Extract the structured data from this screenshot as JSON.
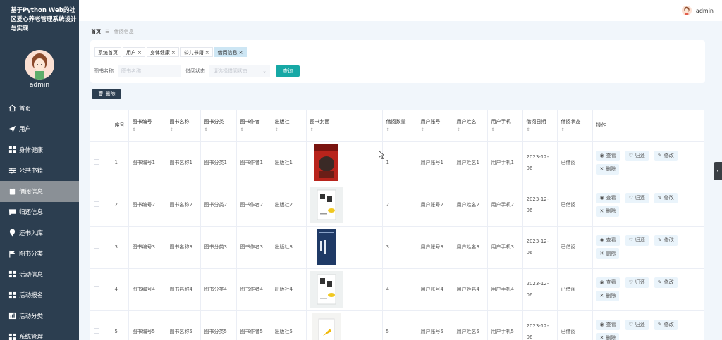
{
  "app": {
    "title": "基于Python Web的社区爱心养老管理系统设计与实现",
    "username": "admin"
  },
  "sidebar": {
    "items": [
      {
        "label": "首页",
        "icon": "home-icon"
      },
      {
        "label": "用户",
        "icon": "send-icon"
      },
      {
        "label": "身体健康",
        "icon": "grid-icon"
      },
      {
        "label": "公共书籍",
        "icon": "sliders-icon"
      },
      {
        "label": "借阅信息",
        "icon": "clipboard-icon",
        "active": true
      },
      {
        "label": "归还信息",
        "icon": "chat-icon"
      },
      {
        "label": "还书入库",
        "icon": "pin-icon"
      },
      {
        "label": "图书分类",
        "icon": "flag-icon"
      },
      {
        "label": "活动信息",
        "icon": "grid-icon"
      },
      {
        "label": "活动报名",
        "icon": "grid-icon"
      },
      {
        "label": "活动分类",
        "icon": "chart-icon"
      },
      {
        "label": "系统管理",
        "icon": "grid-icon"
      }
    ]
  },
  "topbar": {
    "username": "admin"
  },
  "breadcrumb": {
    "home": "首页",
    "separator": "☰",
    "current": "借阅信息"
  },
  "tabs": [
    {
      "label": "系统首页",
      "closable": false
    },
    {
      "label": "用户",
      "closable": true
    },
    {
      "label": "身体健康",
      "closable": true
    },
    {
      "label": "公共书籍",
      "closable": true
    },
    {
      "label": "借阅信息",
      "closable": true,
      "active": true
    }
  ],
  "search": {
    "name_label": "图书名称",
    "name_placeholder": "图书名称",
    "status_label": "借阅状态",
    "status_placeholder": "请选择借阅状态",
    "query_label": "查询"
  },
  "toolbar": {
    "delete_label": "删除"
  },
  "table": {
    "columns": [
      "序号",
      "图书编号",
      "图书名称",
      "图书分类",
      "图书作者",
      "出版社",
      "图书封面",
      "借阅数量",
      "用户账号",
      "用户姓名",
      "用户手机",
      "借阅日期",
      "借阅状态",
      "操作"
    ],
    "sortable": [
      false,
      true,
      true,
      true,
      true,
      true,
      true,
      true,
      true,
      true,
      true,
      true,
      true,
      false
    ],
    "rows": [
      {
        "index": "1",
        "code": "图书编号1",
        "name": "图书名称1",
        "category": "图书分类1",
        "author": "图书作者1",
        "publisher": "出版社1",
        "cover": "red",
        "qty": "1",
        "account": "用户账号1",
        "uname": "用户姓名1",
        "phone": "用户手机1",
        "date": "2023-12-06",
        "status": "已借阅"
      },
      {
        "index": "2",
        "code": "图书编号2",
        "name": "图书名称2",
        "category": "图书分类2",
        "author": "图书作者2",
        "publisher": "出版社2",
        "cover": "white",
        "qty": "2",
        "account": "用户账号2",
        "uname": "用户姓名2",
        "phone": "用户手机2",
        "date": "2023-12-06",
        "status": "已借阅"
      },
      {
        "index": "3",
        "code": "图书编号3",
        "name": "图书名称3",
        "category": "图书分类3",
        "author": "图书作者3",
        "publisher": "出版社3",
        "cover": "blue",
        "qty": "3",
        "account": "用户账号3",
        "uname": "用户姓名3",
        "phone": "用户手机3",
        "date": "2023-12-06",
        "status": "已借阅"
      },
      {
        "index": "4",
        "code": "图书编号4",
        "name": "图书名称4",
        "category": "图书分类4",
        "author": "图书作者4",
        "publisher": "出版社4",
        "cover": "white",
        "qty": "4",
        "account": "用户账号4",
        "uname": "用户姓名4",
        "phone": "用户手机4",
        "date": "2023-12-06",
        "status": "已借阅"
      },
      {
        "index": "5",
        "code": "图书编号5",
        "name": "图书名称5",
        "category": "图书分类5",
        "author": "图书作者5",
        "publisher": "出版社5",
        "cover": "yellow",
        "qty": "5",
        "account": "用户账号5",
        "uname": "用户姓名5",
        "phone": "用户手机5",
        "date": "2023-12-06",
        "status": "已借阅"
      }
    ],
    "actions": {
      "view": "查看",
      "return": "归还",
      "edit": "修改",
      "delete": "删除"
    }
  },
  "colors": {
    "sidebar": "#2c3e50",
    "accent": "#16a8a5",
    "active_tab": "#cde6f4"
  }
}
